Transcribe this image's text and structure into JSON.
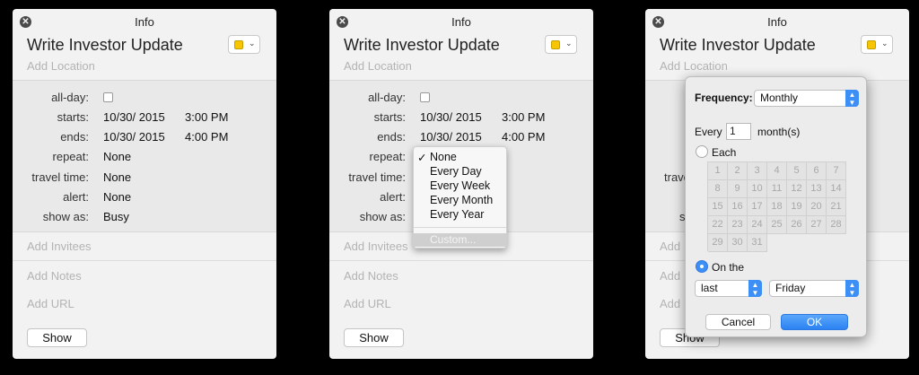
{
  "window": {
    "title": "Info"
  },
  "event": {
    "title": "Write Investor Update",
    "add_location": "Add Location",
    "color": "#f7c600"
  },
  "labels": {
    "allday": "all-day:",
    "starts": "starts:",
    "ends": "ends:",
    "repeat": "repeat:",
    "travel": "travel time:",
    "alert": "alert:",
    "showas": "show as:"
  },
  "values": {
    "start_date": "10/30/ 2015",
    "start_time": "3:00 PM",
    "end_date": "10/30/ 2015",
    "end_time": "4:00 PM",
    "repeat": "None",
    "travel": "None",
    "alert": "None",
    "showas": "Busy"
  },
  "sections": {
    "invitees": "Add Invitees",
    "notes": "Add Notes",
    "url": "Add URL"
  },
  "show_button": "Show",
  "panel3_partial": {
    "travel": "trave",
    "showas": "s",
    "add": "Add",
    "show_button": "Show"
  },
  "repeat_menu": {
    "check": "✓",
    "items": [
      "None",
      "Every Day",
      "Every Week",
      "Every Month",
      "Every Year"
    ],
    "custom": "Custom..."
  },
  "recurrence": {
    "frequency_label": "Frequency:",
    "frequency_value": "Monthly",
    "every_label": "Every",
    "every_value": "1",
    "every_unit": "month(s)",
    "each_label": "Each",
    "days": [
      "1",
      "2",
      "3",
      "4",
      "5",
      "6",
      "7",
      "8",
      "9",
      "10",
      "11",
      "12",
      "13",
      "14",
      "15",
      "16",
      "17",
      "18",
      "19",
      "20",
      "21",
      "22",
      "23",
      "24",
      "25",
      "26",
      "27",
      "28",
      "29",
      "30",
      "31"
    ],
    "on_the_label": "On the",
    "ordinal": "last",
    "weekday": "Friday",
    "cancel": "Cancel",
    "ok": "OK"
  }
}
